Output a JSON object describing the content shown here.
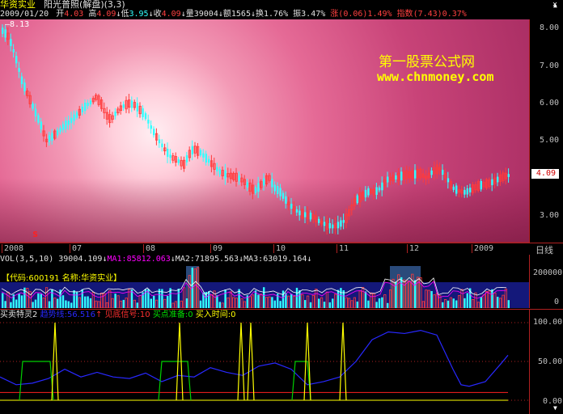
{
  "header": {
    "stock_name": "华资实业",
    "chart_mode": "阳光普照(解盘)(3,3)",
    "date": "2009/01/20",
    "open_label": "开",
    "open": "4.03",
    "high_label": "高",
    "high": "4.09",
    "low_label": "低",
    "low": "3.95",
    "close_label": "收",
    "close": "4.09",
    "volume_label": "量",
    "volume": "39004",
    "amount_label": "额",
    "amount": "1565",
    "turnover_label": "换",
    "turnover": "1.76%",
    "amplitude_label": "振",
    "amplitude": "3.47%",
    "change_label": "涨",
    "change": "(0.06)1.49%",
    "index_label": "指数",
    "index": "(7.43)0.37%"
  },
  "main": {
    "high_marker": "8.13",
    "watermark_title": "第一股票公式网",
    "watermark_url": "www.chnmoney.com",
    "price_axis": [
      "8.00",
      "7.00",
      "6.00",
      "5.00",
      "3.00"
    ],
    "current_price": "4.09",
    "signal_marker": "s"
  },
  "time_axis": {
    "labels": [
      "2008",
      "07",
      "08",
      "09",
      "10",
      "11",
      "12",
      "2009"
    ],
    "period": "日线"
  },
  "volume": {
    "title": "VOL(3,5,10)",
    "vol": "39004.109",
    "ma1_label": "MA1:",
    "ma1": "85812.063",
    "ma2_label": "MA2:",
    "ma2": "71895.563",
    "ma3_label": "MA3:",
    "ma3": "63019.164",
    "info_code_label": "【代码:",
    "info_code": "600191",
    "info_name_label": "名称:",
    "info_name": "华资实业】",
    "axis": [
      "200000",
      "0"
    ]
  },
  "indicator": {
    "name": "买卖特灵2",
    "trend_label": "趋势线",
    "trend": "56.516",
    "bottom_label": "见底信号",
    "bottom": "10",
    "buy_prep_label": "买点准备",
    "buy_prep": "0",
    "buy_time_label": "买入时间",
    "buy_time": "0",
    "axis": [
      "100.00",
      "50.00",
      "0.00"
    ]
  },
  "colors": {
    "up": "#ff3b3b",
    "down": "#32ffff",
    "yellow": "#ffff00",
    "green": "#00d000",
    "blue": "#2828ff",
    "magenta": "#ff00ff"
  },
  "window_controls": [
    "close-icon",
    "scroll-up-icon",
    "scroll-down-icon"
  ]
}
